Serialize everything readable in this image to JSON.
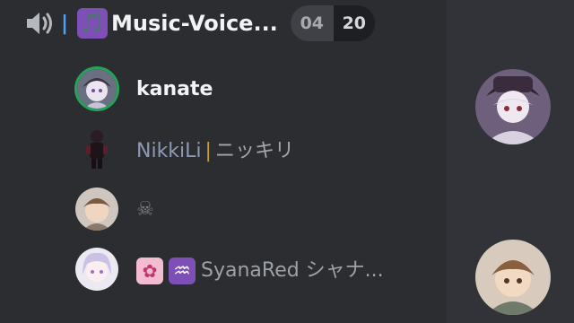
{
  "channel": {
    "prefix_bar": "|",
    "note_icon": "🎵",
    "name": "Music-Voice...",
    "user_count": "04",
    "user_limit": "20"
  },
  "members": [
    {
      "name": "kanate",
      "speaking": true
    },
    {
      "name_a": "NikkiLi",
      "separator": "|",
      "name_b": "ニッキリ"
    },
    {
      "name": "☠"
    },
    {
      "emoji_1": "✿",
      "emoji_2": "♒",
      "name": "SyanaRed シャナ..."
    }
  ],
  "icons": [
    "speaker-icon",
    "music-note-icon",
    "skull-icon",
    "cherry-blossom-icon",
    "aquarius-icon"
  ],
  "colors": {
    "background": "#2b2d31",
    "right_panel": "#313338",
    "speaking_ring": "#23a559",
    "bar_accent": "#4ea1ff",
    "note_icon_bg": "#7f4fb8"
  }
}
